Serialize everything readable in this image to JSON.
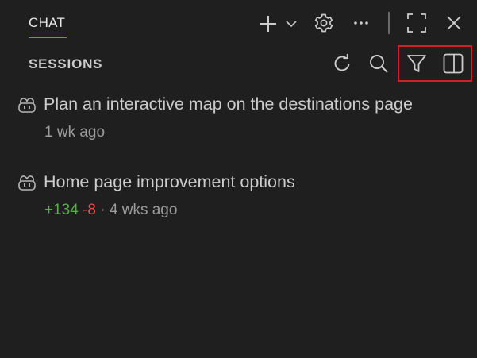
{
  "header": {
    "tab_label": "CHAT",
    "icons": [
      "plus-icon",
      "chevron-down-icon",
      "gear-icon",
      "ellipsis-icon",
      "maximize-icon",
      "close-icon"
    ]
  },
  "sessions_header": {
    "title": "SESSIONS",
    "icons": [
      "refresh-icon",
      "search-icon",
      "filter-icon",
      "split-panel-icon"
    ]
  },
  "sessions": [
    {
      "title": "Plan an interactive map on the destinations page",
      "time": "1 wk ago"
    },
    {
      "title": "Home page improvement options",
      "added": "+134",
      "removed": "-8",
      "separator": "·",
      "time": "4 wks ago"
    }
  ],
  "colors": {
    "background": "#1f1f1f",
    "tab_underline": "#3794ff",
    "added": "#4fb53f",
    "removed": "#f14c4c",
    "highlight": "#d21f1f"
  }
}
